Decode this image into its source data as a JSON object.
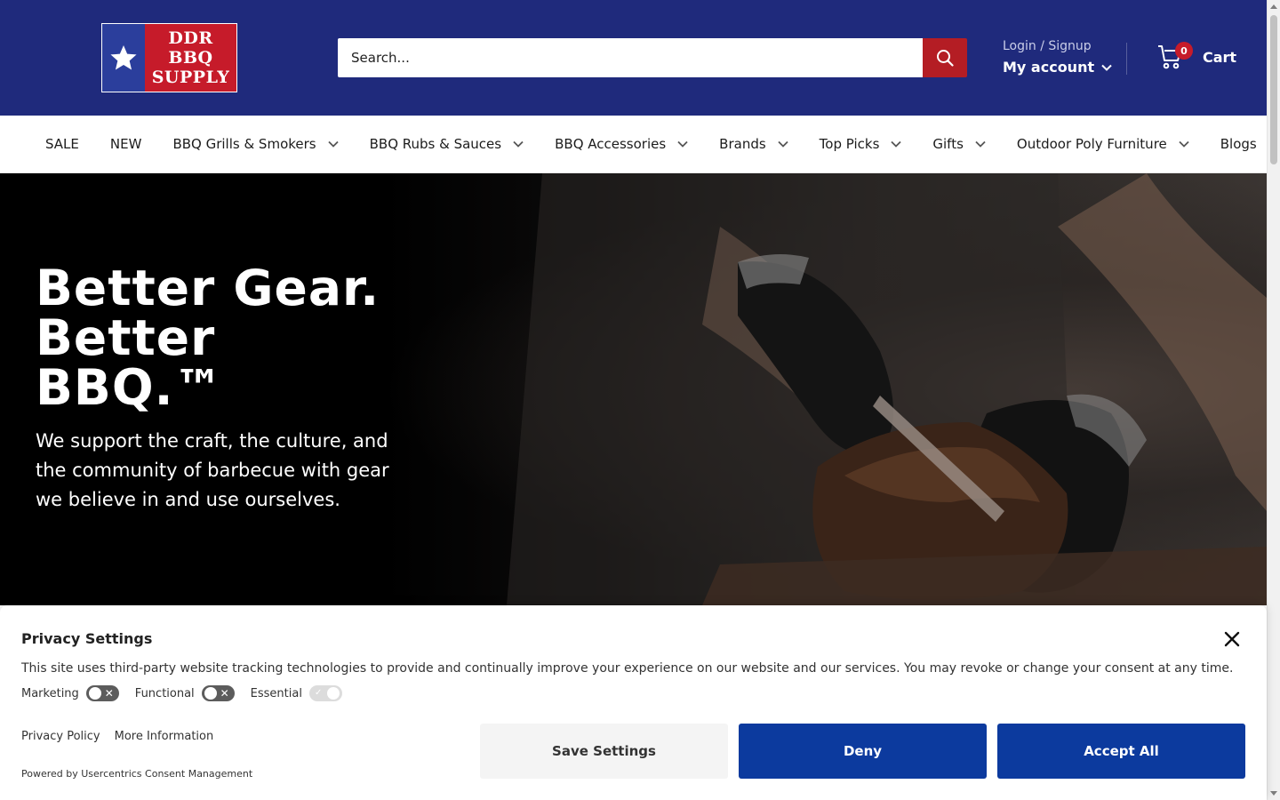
{
  "header": {
    "logo_lines": [
      "DDR",
      "BBQ",
      "SUPPLY"
    ],
    "search_placeholder": "Search...",
    "login_label": "Login / Signup",
    "account_label": "My account",
    "cart_count": "0",
    "cart_label": "Cart",
    "brand_color": "#1f2a7c",
    "accent_color": "#b41d24"
  },
  "nav": {
    "items": [
      {
        "label": "SALE",
        "dropdown": false
      },
      {
        "label": "NEW",
        "dropdown": false
      },
      {
        "label": "BBQ Grills & Smokers",
        "dropdown": true
      },
      {
        "label": "BBQ Rubs & Sauces",
        "dropdown": true
      },
      {
        "label": "BBQ Accessories",
        "dropdown": true
      },
      {
        "label": "Brands",
        "dropdown": true
      },
      {
        "label": "Top Picks",
        "dropdown": true
      },
      {
        "label": "Gifts",
        "dropdown": true
      },
      {
        "label": "Outdoor Poly Furniture",
        "dropdown": true
      },
      {
        "label": "Blogs",
        "dropdown": false
      }
    ]
  },
  "hero": {
    "title_lines": [
      "Better Gear.",
      "Better",
      "BBQ.™"
    ],
    "subtitle": "We support the craft, the culture, and the community of barbecue with gear we believe in and use ourselves."
  },
  "privacy": {
    "title": "Privacy Settings",
    "description": "This site uses third-party website tracking technologies to provide and continually improve your experience on our website and our services. You may revoke or change your consent at any time.",
    "toggles": [
      {
        "label": "Marketing",
        "enabled": false,
        "locked": false
      },
      {
        "label": "Functional",
        "enabled": false,
        "locked": false
      },
      {
        "label": "Essential",
        "enabled": true,
        "locked": true
      }
    ],
    "links": [
      "Privacy Policy",
      "More Information"
    ],
    "powered_by": "Powered by Usercentrics Consent Management",
    "buttons": {
      "save": "Save Settings",
      "deny": "Deny",
      "accept": "Accept All"
    },
    "button_color": "#0c3a9e"
  }
}
